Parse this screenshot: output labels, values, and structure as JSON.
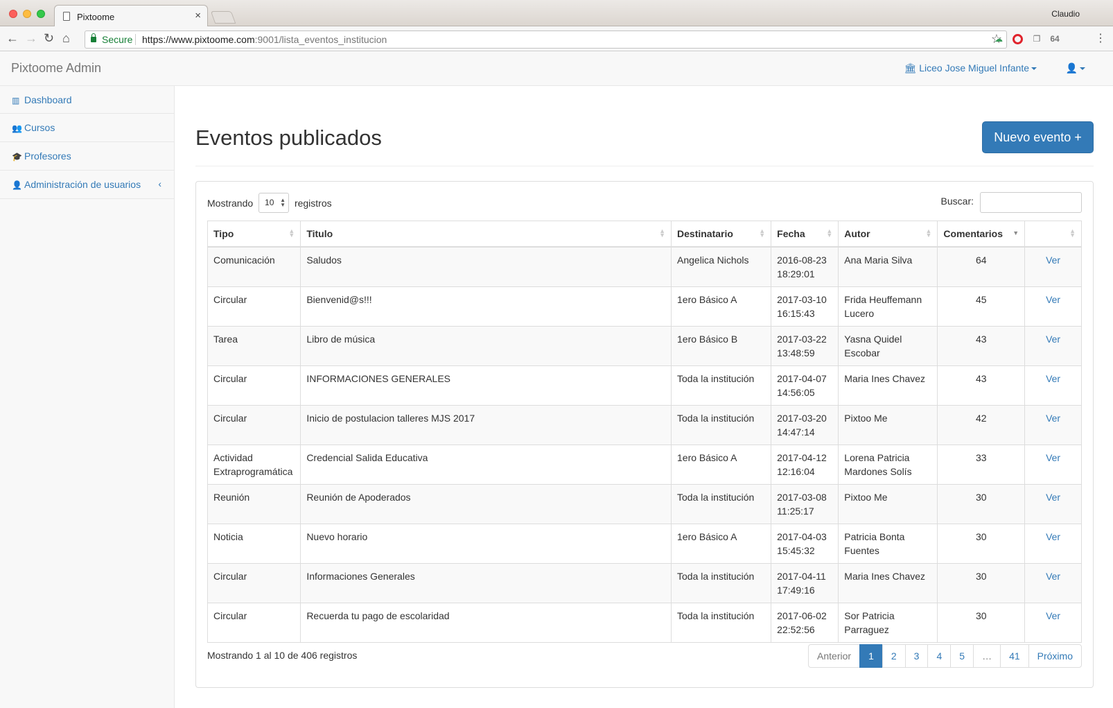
{
  "browser": {
    "tab_title": "Pixtoome",
    "profile_name": "Claudio",
    "secure_label": "Secure",
    "url_host": "https://www.pixtoome.com",
    "url_rest": ":9001/lista_eventos_institucion",
    "ext_badge": "64"
  },
  "navbar": {
    "brand": "Pixtoome Admin",
    "institution": "Liceo Jose Miguel Infante"
  },
  "sidebar": {
    "items": [
      {
        "label": "Dashboard",
        "icon": "bar-chart-icon"
      },
      {
        "label": "Cursos",
        "icon": "users-icon"
      },
      {
        "label": "Profesores",
        "icon": "graduation-cap-icon"
      },
      {
        "label": "Administración de usuarios",
        "icon": "user-icon"
      }
    ]
  },
  "page": {
    "title": "Eventos publicados",
    "new_button": "Nuevo evento +"
  },
  "table_controls": {
    "show_prefix": "Mostrando",
    "page_length": "10",
    "show_suffix": "registros",
    "search_label": "Buscar:",
    "search_value": ""
  },
  "table": {
    "columns": [
      "Tipo",
      "Titulo",
      "Destinatario",
      "Fecha",
      "Autor",
      "Comentarios",
      ""
    ],
    "rows": [
      {
        "tipo": "Comunicación",
        "titulo": "Saludos",
        "destinatario": "Angelica Nichols",
        "fecha_d": "2016-08-23",
        "fecha_t": "18:29:01",
        "autor": "Ana Maria Silva",
        "comentarios": "64",
        "accion": "Ver"
      },
      {
        "tipo": "Circular",
        "titulo": "Bienvenid@s!!!",
        "destinatario": "1ero Básico A",
        "fecha_d": "2017-03-10",
        "fecha_t": "16:15:43",
        "autor": "Frida Heuffemann Lucero",
        "comentarios": "45",
        "accion": "Ver"
      },
      {
        "tipo": "Tarea",
        "titulo": "Libro de música",
        "destinatario": "1ero Básico B",
        "fecha_d": "2017-03-22",
        "fecha_t": "13:48:59",
        "autor": "Yasna Quidel Escobar",
        "comentarios": "43",
        "accion": "Ver"
      },
      {
        "tipo": "Circular",
        "titulo": "INFORMACIONES GENERALES",
        "destinatario": "Toda la institución",
        "fecha_d": "2017-04-07",
        "fecha_t": "14:56:05",
        "autor": "Maria Ines Chavez",
        "comentarios": "43",
        "accion": "Ver"
      },
      {
        "tipo": "Circular",
        "titulo": "Inicio de postulacion talleres MJS 2017",
        "destinatario": "Toda la institución",
        "fecha_d": "2017-03-20",
        "fecha_t": "14:47:14",
        "autor": "Pixtoo Me",
        "comentarios": "42",
        "accion": "Ver"
      },
      {
        "tipo": "Actividad Extraprogramática",
        "titulo": "Credencial Salida Educativa",
        "destinatario": "1ero Básico A",
        "fecha_d": "2017-04-12",
        "fecha_t": "12:16:04",
        "autor": "Lorena Patricia Mardones Solís",
        "comentarios": "33",
        "accion": "Ver"
      },
      {
        "tipo": "Reunión",
        "titulo": "Reunión de Apoderados",
        "destinatario": "Toda la institución",
        "fecha_d": "2017-03-08",
        "fecha_t": "11:25:17",
        "autor": "Pixtoo Me",
        "comentarios": "30",
        "accion": "Ver"
      },
      {
        "tipo": "Noticia",
        "titulo": "Nuevo horario",
        "destinatario": "1ero Básico A",
        "fecha_d": "2017-04-03",
        "fecha_t": "15:45:32",
        "autor": "Patricia Bonta Fuentes",
        "comentarios": "30",
        "accion": "Ver"
      },
      {
        "tipo": "Circular",
        "titulo": "Informaciones Generales",
        "destinatario": "Toda la institución",
        "fecha_d": "2017-04-11",
        "fecha_t": "17:49:16",
        "autor": "Maria Ines Chavez",
        "comentarios": "30",
        "accion": "Ver"
      },
      {
        "tipo": "Circular",
        "titulo": "Recuerda tu pago de escolaridad",
        "destinatario": "Toda la institución",
        "fecha_d": "2017-06-02",
        "fecha_t": "22:52:56",
        "autor": "Sor Patricia Parraguez",
        "comentarios": "30",
        "accion": "Ver"
      }
    ]
  },
  "footer": {
    "info": "Mostrando 1 al 10 de 406 registros",
    "pagination": {
      "prev": "Anterior",
      "pages": [
        "1",
        "2",
        "3",
        "4",
        "5",
        "…",
        "41"
      ],
      "active": "1",
      "next": "Próximo"
    }
  },
  "colors": {
    "primary": "#337ab7",
    "secure_green": "#188038"
  }
}
